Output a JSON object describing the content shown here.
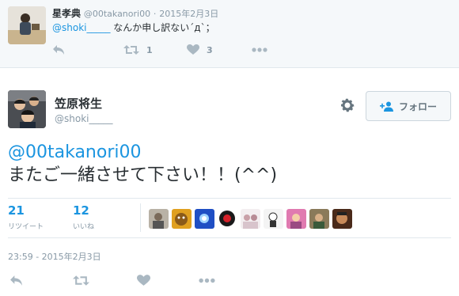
{
  "reply": {
    "display_name": "星孝典",
    "handle": "@00takanori00",
    "separator": "·",
    "date": "2015年2月3日",
    "mention": "@shoki_____",
    "text": " なんか申し訳ない´д`；",
    "actions": {
      "reply_icon": "reply-icon",
      "retweet_icon": "retweet-icon",
      "retweet_count": "1",
      "like_icon": "heart-icon",
      "like_count": "3",
      "more_icon": "more-icon"
    }
  },
  "tweet": {
    "display_name": "笠原将生",
    "handle": "@shoki_____",
    "follow_label": "フォロー",
    "follow_icon": "add-user-icon",
    "settings_icon": "gear-icon",
    "mention": "@00takanori00",
    "body": "またご一緒させて下さい！！(^^)",
    "stats": {
      "retweets_value": "21",
      "retweets_label": "リツイート",
      "likes_value": "12",
      "likes_label": "いいね"
    },
    "likers_count": 9,
    "timestamp": "23:59 - 2015年2月3日",
    "actions": {
      "reply_icon": "reply-icon",
      "retweet_icon": "retweet-icon",
      "like_icon": "heart-icon",
      "more_icon": "more-icon"
    }
  },
  "colors": {
    "link": "#1b95e0",
    "muted": "#8899a6",
    "icon": "#aab8c2",
    "text": "#292f33",
    "border": "#e1e8ed",
    "reply_bg": "#f5f8fa"
  }
}
